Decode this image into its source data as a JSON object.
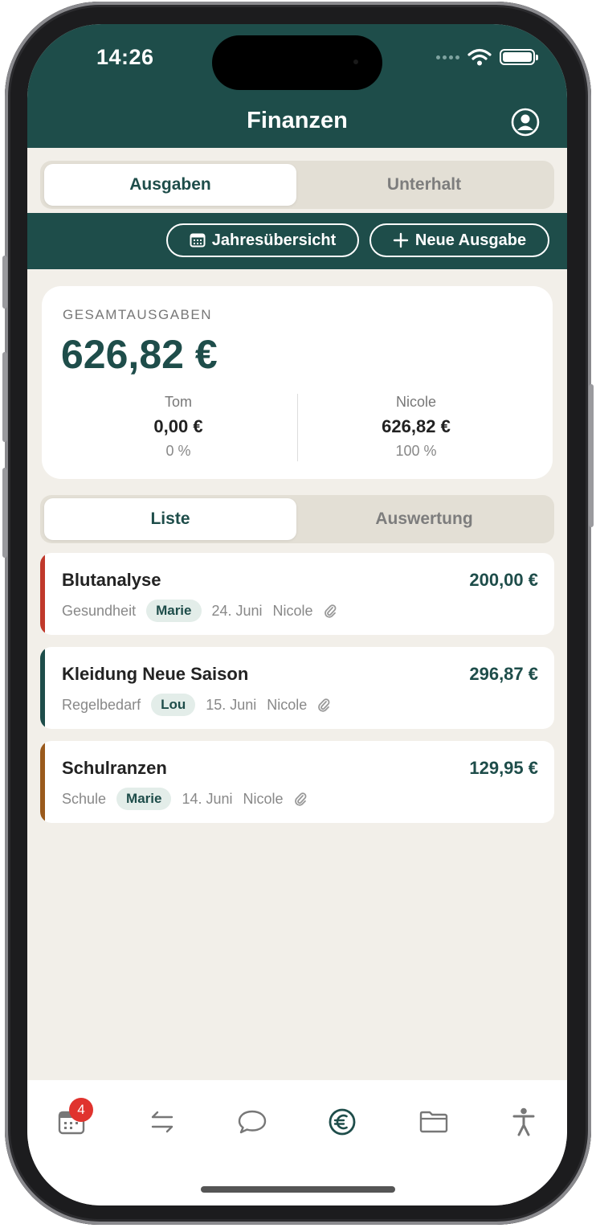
{
  "status": {
    "time": "14:26"
  },
  "header": {
    "title": "Finanzen"
  },
  "segment_top": {
    "options": [
      "Ausgaben",
      "Unterhalt"
    ],
    "selected": "Ausgaben"
  },
  "actions": {
    "yearly": "Jahresübersicht",
    "new_expense": "Neue Ausgabe"
  },
  "summary": {
    "label": "GESAMTAUSGABEN",
    "total": "626,82 €",
    "people": [
      {
        "name": "Tom",
        "amount": "0,00 €",
        "percent": "0 %"
      },
      {
        "name": "Nicole",
        "amount": "626,82 €",
        "percent": "100 %"
      }
    ]
  },
  "segment_view": {
    "options": [
      "Liste",
      "Auswertung"
    ],
    "selected": "Liste"
  },
  "expenses": [
    {
      "title": "Blutanalyse",
      "amount": "200,00 €",
      "category": "Gesundheit",
      "child": "Marie",
      "date": "24. Juni",
      "payer": "Nicole",
      "color": "#c0392b"
    },
    {
      "title": "Kleidung Neue Saison",
      "amount": "296,87 €",
      "category": "Regelbedarf",
      "child": "Lou",
      "date": "15. Juni",
      "payer": "Nicole",
      "color": "#1e4d4a"
    },
    {
      "title": "Schulranzen",
      "amount": "129,95 €",
      "category": "Schule",
      "child": "Marie",
      "date": "14. Juni",
      "payer": "Nicole",
      "color": "#9a5a1c"
    }
  ],
  "tabbar": {
    "items": [
      "calendar-icon",
      "transfer-icon",
      "chat-icon",
      "euro-icon",
      "folder-icon",
      "person-icon"
    ],
    "active": "euro-icon",
    "calendar_badge": "4"
  },
  "colors": {
    "primary": "#1e4d4a",
    "background": "#f2efe9",
    "badge": "#e0332e"
  }
}
